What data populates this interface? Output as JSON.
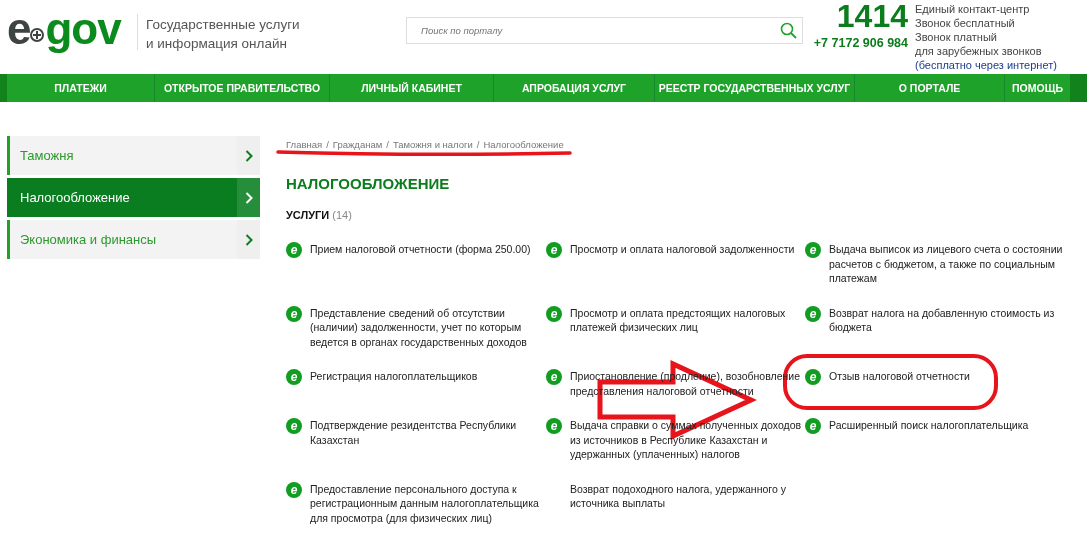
{
  "header": {
    "logo": {
      "left": "e",
      "right": "gov"
    },
    "tagline": [
      "Государственные услуги",
      "и информация онлайн"
    ],
    "search": {
      "placeholder": "Поиск по порталу"
    },
    "phone": {
      "short": "1414",
      "long": "+7 7172 906 984"
    },
    "contact": [
      "Единый контакт-центр",
      "Звонок бесплатный",
      "Звонок платный",
      "для зарубежных звонков"
    ],
    "contact_note": "(бесплатно через интернет)"
  },
  "nav": [
    {
      "label": "ПЛАТЕЖИ"
    },
    {
      "label": "ОТКРЫТОЕ ПРАВИТЕЛЬСТВО"
    },
    {
      "label": "ЛИЧНЫЙ КАБИНЕТ"
    },
    {
      "label": "АПРОБАЦИЯ УСЛУГ"
    },
    {
      "label": "РЕЕСТР ГОСУДАРСТВЕННЫХ УСЛУГ"
    },
    {
      "label": "О ПОРТАЛЕ"
    },
    {
      "label": "ПОМОЩЬ"
    }
  ],
  "sidebar": {
    "items": [
      {
        "label": "Таможня",
        "selected": false
      },
      {
        "label": "Налогообложение",
        "selected": true
      },
      {
        "label": "Экономика и финансы",
        "selected": false
      }
    ]
  },
  "breadcrumb": {
    "separator": "/",
    "items": [
      "Главная",
      "Гражданам",
      "Таможня и налоги",
      "Налогообложение"
    ]
  },
  "title": "НАЛОГООБЛОЖЕНИЕ",
  "services": {
    "label": "УСЛУГИ",
    "count": "(14)",
    "items": [
      {
        "badge": "e",
        "label": "Прием налоговой отчетности (форма 250.00)"
      },
      {
        "badge": "e",
        "label": "Просмотр и оплата налоговой задолженности"
      },
      {
        "badge": "e",
        "label": "Выдача выписок из лицевого счета о состоянии расчетов с бюджетом, а также по социальным платежам"
      },
      {
        "badge": "e",
        "label": "Представление сведений об отсутствии (наличии) задолженности, учет по которым ведется в органах государственных доходов"
      },
      {
        "badge": "e",
        "label": "Просмотр и оплата предстоящих налоговых платежей физических лиц"
      },
      {
        "badge": "e",
        "label": "Возврат налога на добавленную стоимость из бюджета"
      },
      {
        "badge": "e",
        "label": "Регистрация налогоплательщиков"
      },
      {
        "badge": "e",
        "label": "Приостановление (продление), возобновление представления налоговой отчетности"
      },
      {
        "badge": "e",
        "label": "Отзыв налоговой отчетности"
      },
      {
        "badge": "e",
        "label": "Подтверждение резидентства Республики Казахстан"
      },
      {
        "badge": "e",
        "label": "Выдача справки о суммах полученных доходов из источников в Республике Казахстан и удержанных (уплаченных) налогов"
      },
      {
        "badge": "e",
        "label": "Расширенный поиск налогоплательщика"
      },
      {
        "badge": "e",
        "label": "Предоставление персонального доступа к регистрационным данным налогоплательщика для просмотра (для физических лиц)"
      },
      {
        "label": "Возврат подоходного налога, удержанного у источника выплаты"
      }
    ]
  },
  "annotations": [
    {
      "kind": "underline"
    },
    {
      "kind": "arrow"
    },
    {
      "kind": "ellipse"
    }
  ]
}
